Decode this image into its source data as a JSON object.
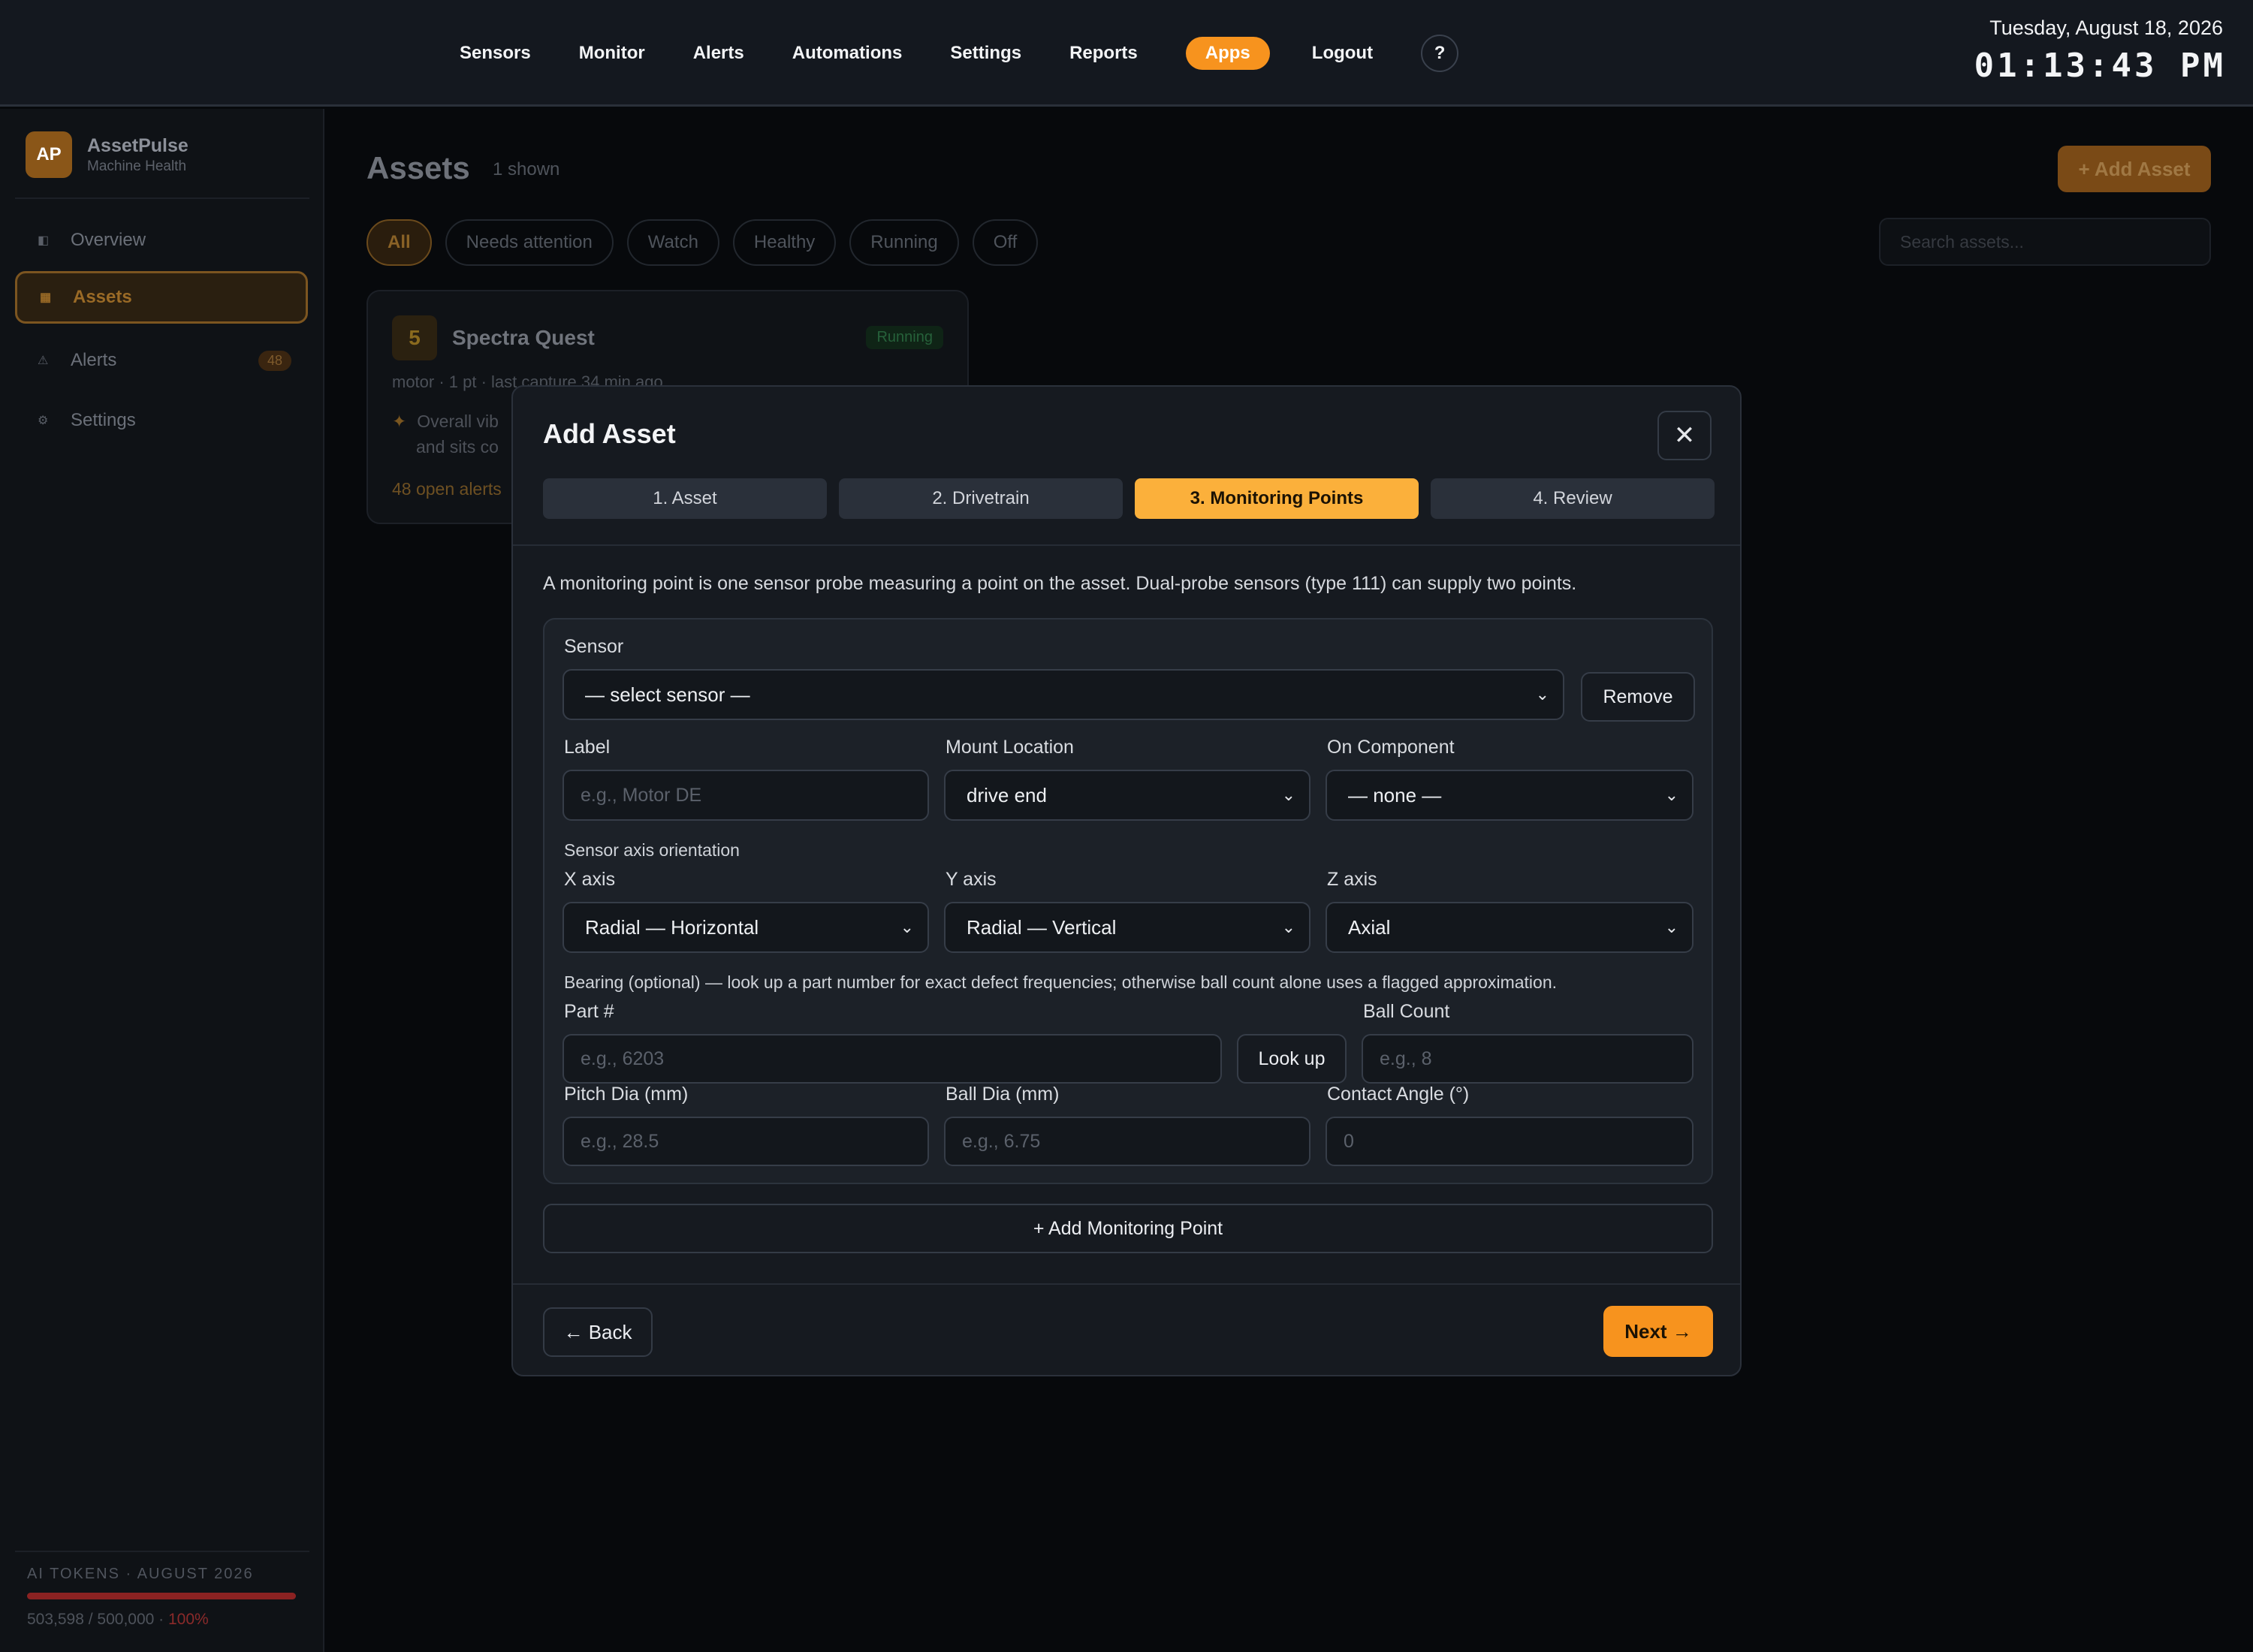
{
  "nav": {
    "items": [
      "Sensors",
      "Monitor",
      "Alerts",
      "Automations",
      "Settings",
      "Reports",
      "Apps",
      "Logout"
    ],
    "active_item": "Apps",
    "help_label": "?"
  },
  "clock": {
    "date": "Tuesday, August 18, 2026",
    "time": "01:13:43 PM"
  },
  "sidebar": {
    "logo": "AP",
    "brand": "AssetPulse",
    "subtitle": "Machine Health",
    "items": [
      {
        "label": "Overview",
        "icon": "overview-icon",
        "glyph": "◧"
      },
      {
        "label": "Assets",
        "icon": "assets-icon",
        "glyph": "▦",
        "active": true
      },
      {
        "label": "Alerts",
        "icon": "alert-triangle-icon",
        "glyph": "⚠",
        "badge": "48"
      },
      {
        "label": "Settings",
        "icon": "gear-icon",
        "glyph": "⚙"
      }
    ],
    "tokens": {
      "title": "AI TOKENS · AUGUST 2026",
      "usage": "503,598 / 500,000 · ",
      "percent": "100%",
      "fill_fraction": 1.0
    }
  },
  "main": {
    "title": "Assets",
    "count": "1 shown",
    "add_button": "+ Add Asset",
    "search_placeholder": "Search assets...",
    "filters": [
      "All",
      "Needs attention",
      "Watch",
      "Healthy",
      "Running",
      "Off"
    ],
    "active_filter": "All",
    "asset_card": {
      "number": "5",
      "name": "Spectra Quest",
      "status": "Running",
      "meta": "motor · 1 pt · last capture 34 min ago",
      "note_line1": "Overall vib",
      "note_line2": "and sits co",
      "alerts": "48 open alerts"
    }
  },
  "modal": {
    "title": "Add Asset",
    "close_label": "✕",
    "steps": [
      "1. Asset",
      "2. Drivetrain",
      "3. Monitoring Points",
      "4. Review"
    ],
    "active_step": 2,
    "intro": "A monitoring point is one sensor probe measuring a point on the asset. Dual-probe sensors (type 111) can supply two points.",
    "point": {
      "sensor_label": "Sensor",
      "sensor_value": "— select sensor —",
      "remove_label": "Remove",
      "label_label": "Label",
      "label_placeholder": "e.g., Motor DE",
      "mount_label": "Mount Location",
      "mount_value": "drive end",
      "component_label": "On Component",
      "component_value": "— none —",
      "orientation_label": "Sensor axis orientation",
      "x_label": "X axis",
      "x_value": "Radial — Horizontal",
      "y_label": "Y axis",
      "y_value": "Radial — Vertical",
      "z_label": "Z axis",
      "z_value": "Axial",
      "bearing_note": "Bearing (optional) — look up a part number for exact defect frequencies; otherwise ball count alone uses a flagged approximation.",
      "part_label": "Part #",
      "part_placeholder": "e.g., 6203",
      "lookup_label": "Look up",
      "ball_count_label": "Ball Count",
      "ball_count_placeholder": "e.g., 8",
      "pitch_label": "Pitch Dia (mm)",
      "pitch_placeholder": "e.g., 28.5",
      "ball_dia_label": "Ball Dia (mm)",
      "ball_dia_placeholder": "e.g., 6.75",
      "angle_label": "Contact Angle (°)",
      "angle_placeholder": "0"
    },
    "add_point_label": "+ Add Monitoring Point",
    "back_label": "← Back",
    "next_label": "Next →"
  }
}
